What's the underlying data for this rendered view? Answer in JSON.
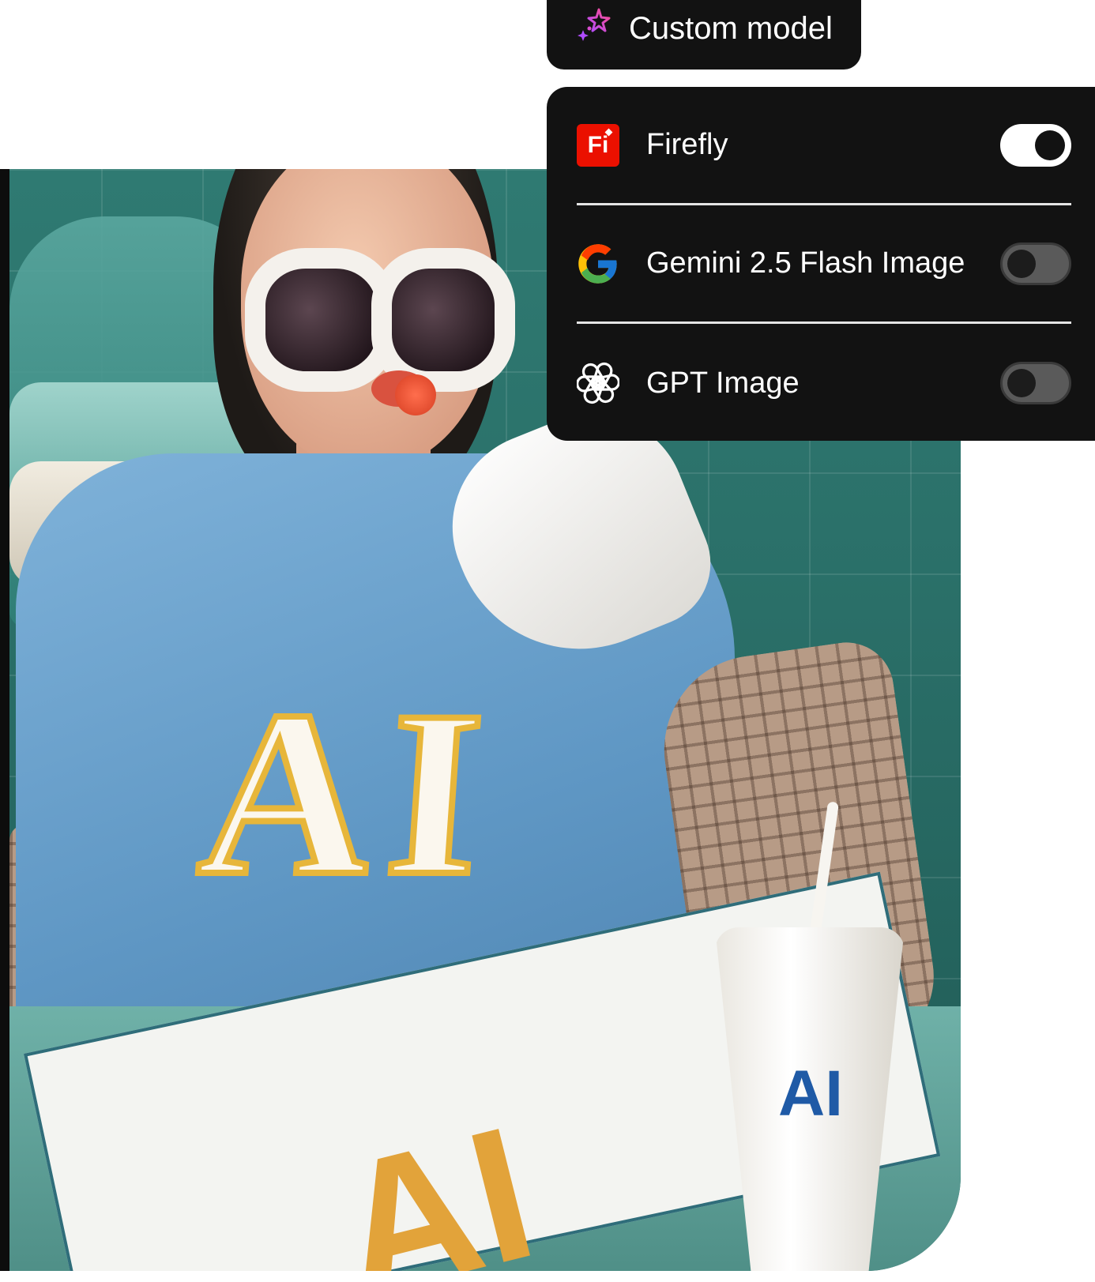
{
  "custom_model": {
    "label": "Custom model",
    "icon": "sparkle-icon"
  },
  "models": [
    {
      "name": "Firefly",
      "icon": "firefly-icon",
      "icon_text": "Fi",
      "enabled": true
    },
    {
      "name": "Gemini 2.5 Flash Image",
      "icon": "google-g-icon",
      "enabled": false
    },
    {
      "name": "GPT Image",
      "icon": "openai-icon",
      "enabled": false
    }
  ],
  "photo": {
    "shirt_text": "AI",
    "glass_text": "AI",
    "placemat_text": "AI"
  },
  "colors": {
    "panel_bg": "#121212",
    "firefly_red": "#eb1000",
    "toggle_on": "#ffffff",
    "toggle_off": "#5a5a5a"
  }
}
